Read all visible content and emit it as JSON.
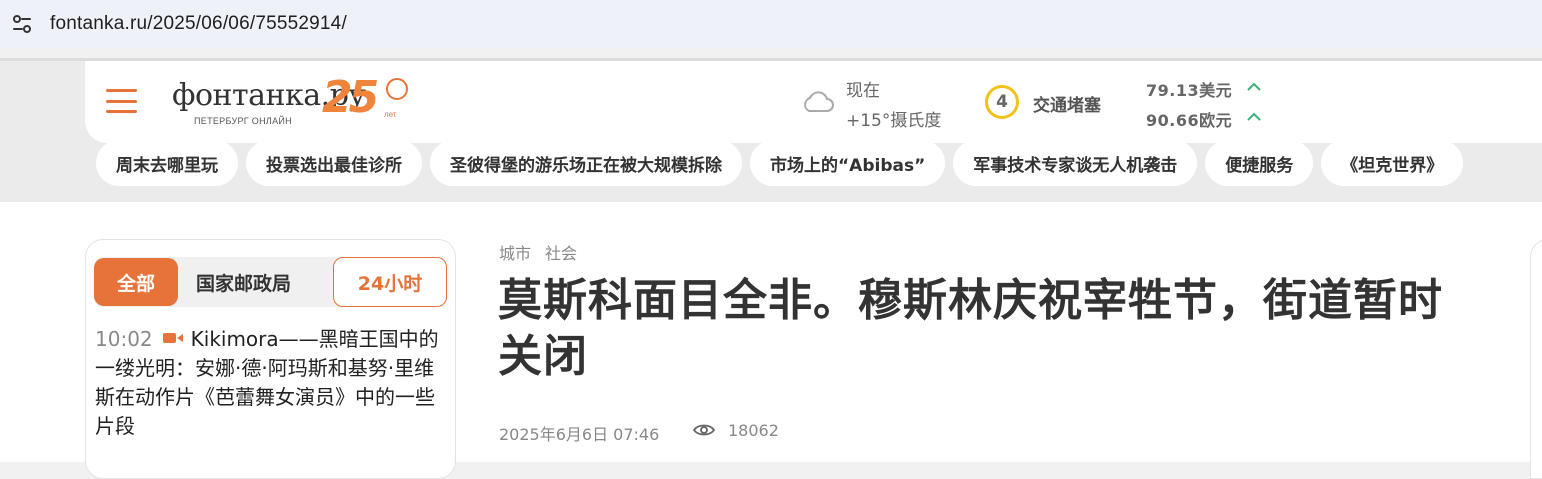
{
  "browser": {
    "url": "fontanka.ru/2025/06/06/75552914/"
  },
  "logo": {
    "word": "фонтанка.ру",
    "sub": "ПЕТЕРБУРГ ОНЛАЙН",
    "anniversary": "25",
    "anniversary_unit": "лет"
  },
  "weather": {
    "now_label": "现在",
    "temp": "+15°摄氏度"
  },
  "traffic": {
    "level": "4",
    "label": "交通堵塞"
  },
  "currency": [
    {
      "text": "79.13美元",
      "trend": "up"
    },
    {
      "text": "90.66欧元",
      "trend": "up"
    }
  ],
  "topics": [
    "周末去哪里玩",
    "投票选出最佳诊所",
    "圣彼得堡的游乐场正在被大规模拆除",
    "市场上的“Abibas”",
    "军事技术专家谈无人机袭击",
    "便捷服务",
    "《坦克世界》"
  ],
  "feed": {
    "tabs": {
      "all": "全部",
      "post": "国家邮政局",
      "h24": "24小时"
    },
    "item": {
      "time": "10:02",
      "text": "Kikimora——黑暗王国中的一缕光明：安娜·德·阿玛斯和基努·里维斯在动作片《芭蕾舞女演员》中的一些片段"
    }
  },
  "article": {
    "breadcrumbs": [
      "城市",
      "社会"
    ],
    "title": "莫斯科面目全非。穆斯林庆祝宰牲节，街道暂时关闭",
    "date": "2025年6月6日 07:46",
    "views": "18062"
  },
  "colors": {
    "accent": "#e8733a",
    "traffic": "#f2c21a",
    "up": "#3bb07a"
  }
}
